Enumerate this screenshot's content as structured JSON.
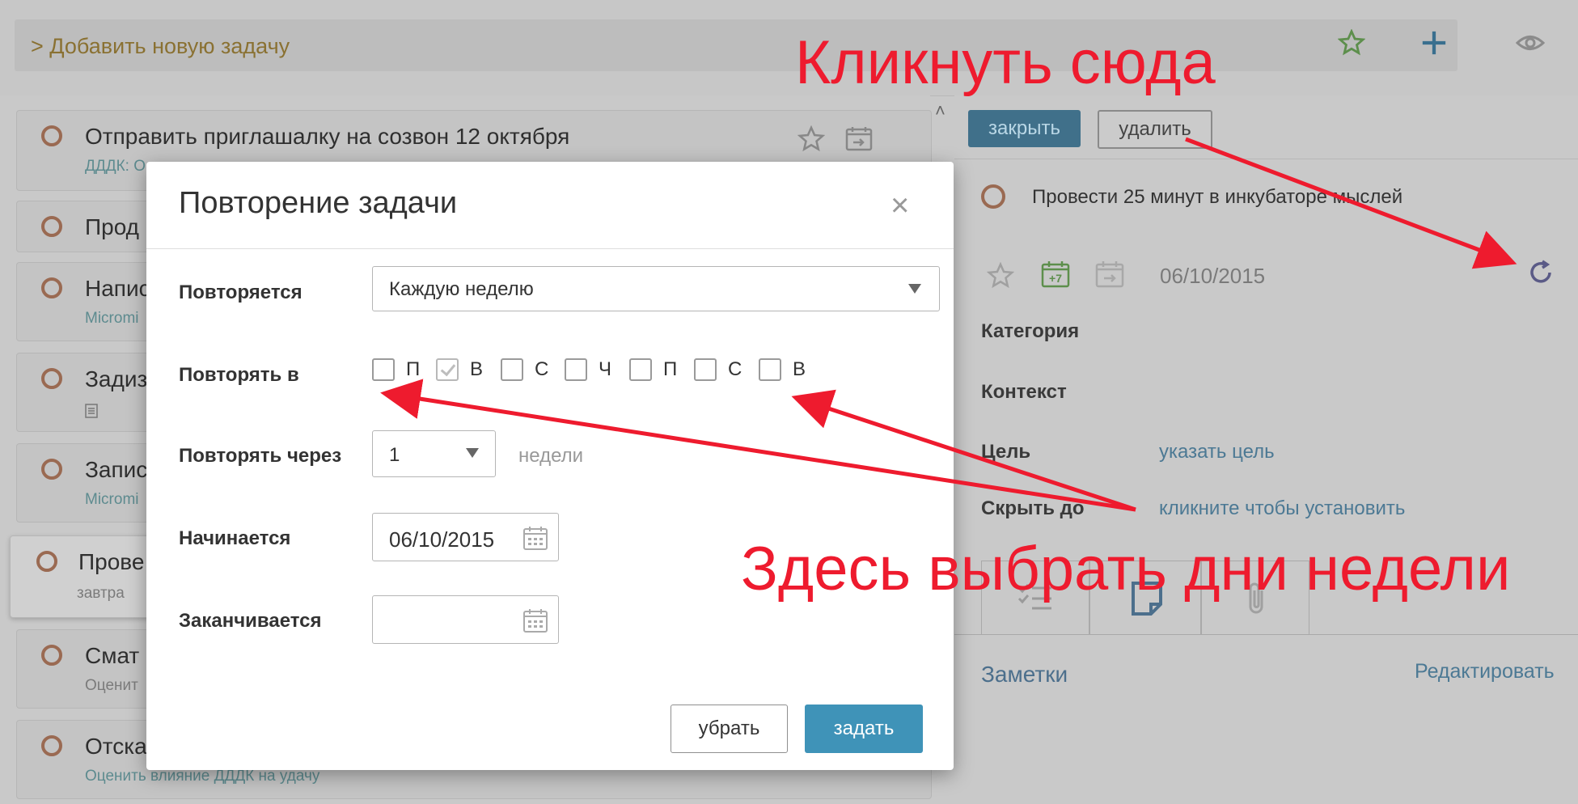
{
  "topbar": {
    "add_task_label": "> Добавить новую задачу"
  },
  "tasks": [
    {
      "title": "Отправить приглашалку на созвон 12 октября",
      "sub": "ДДДК: О"
    },
    {
      "title": "Прод",
      "sub": ""
    },
    {
      "title": "Напис",
      "sub": "Micromi"
    },
    {
      "title": "Задиз",
      "sub": ""
    },
    {
      "title": "Запис",
      "sub": "Micromi"
    },
    {
      "title": "Прове",
      "sub": "завтра"
    },
    {
      "title": "Смат",
      "sub": "Оценит"
    },
    {
      "title": "Отска",
      "sub": "Оценить влияние ДДДК на удачу"
    }
  ],
  "detail": {
    "close_button": "закрыть",
    "delete_button": "удалить",
    "task_title": "Провести 25 минут в инкубаторе мыслей",
    "plus7_badge": "+7",
    "date": "06/10/2015",
    "category_label": "Категория",
    "context_label": "Контекст",
    "goal_label": "Цель",
    "goal_link": "указать цель",
    "hide_label": "Скрыть до",
    "hide_link": "кликните чтобы установить",
    "notes_label": "Заметки",
    "edit_link": "Редактировать"
  },
  "modal": {
    "title": "Повторение задачи",
    "close_glyph": "×",
    "repeats_label": "Повторяется",
    "repeats_value": "Каждую неделю",
    "repeat_on_label": "Повторять в",
    "days": [
      {
        "letter": "П",
        "checked": false
      },
      {
        "letter": "В",
        "checked": true
      },
      {
        "letter": "С",
        "checked": false
      },
      {
        "letter": "Ч",
        "checked": false
      },
      {
        "letter": "П",
        "checked": false
      },
      {
        "letter": "С",
        "checked": false
      },
      {
        "letter": "В",
        "checked": false
      }
    ],
    "repeat_every_label": "Повторять через",
    "repeat_every_value": "1",
    "repeat_every_unit": "недели",
    "starts_label": "Начинается",
    "starts_value": "06/10/2015",
    "ends_label": "Заканчивается",
    "ends_value": "",
    "remove_button": "убрать",
    "set_button": "задать"
  },
  "annotations": {
    "top": "Кликнуть сюда",
    "middle": "Здесь выбрать дни недели",
    "color": "#ee1b2e"
  },
  "colors": {
    "primary_button": "#3f93b8",
    "link": "#4c7994",
    "task_circle": "#9a6a52"
  }
}
